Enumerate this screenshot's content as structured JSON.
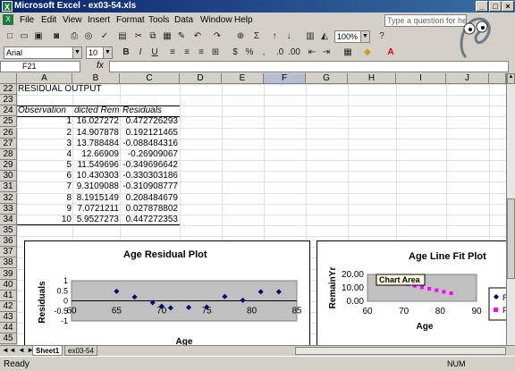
{
  "window": {
    "app": "Microsoft Excel",
    "file": "ex03-54.xls",
    "title": "Microsoft Excel - ex03-54.xls"
  },
  "menu": [
    "File",
    "Edit",
    "View",
    "Insert",
    "Format",
    "Tools",
    "Data",
    "Window",
    "Help"
  ],
  "help_box": {
    "placeholder": "Type a question for help"
  },
  "toolbar": {
    "zoom": "100%",
    "font": "Arial",
    "size": "10"
  },
  "formula_bar": {
    "name_box": "F21",
    "fx": "fx",
    "content": ""
  },
  "columns": [
    "A",
    "B",
    "C",
    "D",
    "E",
    "F",
    "G",
    "H",
    "I",
    "J"
  ],
  "selected_column": "F",
  "rows": [
    "22",
    "23",
    "24",
    "25",
    "26",
    "27",
    "28",
    "29",
    "30",
    "31",
    "32",
    "33",
    "34",
    "35",
    "36",
    "37",
    "38",
    "39",
    "40",
    "41",
    "42",
    "43",
    "44",
    "45"
  ],
  "residual_output": {
    "heading": "RESIDUAL OUTPUT",
    "headers": [
      "Observation",
      "Predicted Rema",
      "Residuals"
    ],
    "header_shown": "dicted Rema",
    "data": [
      [
        "1",
        "16.027272",
        "0.472726293"
      ],
      [
        "2",
        "14.907878",
        "0.192121465"
      ],
      [
        "3",
        "13.788484",
        "-0.088484316"
      ],
      [
        "4",
        "12.66909",
        "-0.26909067"
      ],
      [
        "5",
        "11.549696",
        "-0.349696642"
      ],
      [
        "6",
        "10.430303",
        "-0.330303186"
      ],
      [
        "7",
        "9.3109088",
        "-0.310908777"
      ],
      [
        "8",
        "8.1915149",
        "0.208484679"
      ],
      [
        "9",
        "7.0721211",
        "0.027878802"
      ],
      [
        "10",
        "5.9527273",
        "0.447272353"
      ]
    ]
  },
  "charts": {
    "residual": {
      "title": "Age  Residual Plot",
      "ylabel": "Residuals",
      "xlabel": "Age",
      "yticks": [
        "1",
        "0.5",
        "0",
        "-0.5",
        "-1"
      ],
      "xticks": [
        "60",
        "65",
        "70",
        "75",
        "80",
        "85"
      ]
    },
    "linefit": {
      "title": "Age Line Fit  Plot",
      "ylabel": "RemainYr",
      "xlabel": "Age",
      "yticks": [
        "20.00",
        "10.00",
        "0.00"
      ],
      "xticks": [
        "60",
        "70",
        "80",
        "90"
      ],
      "tooltip": "Chart Area",
      "legend": [
        "R",
        "P"
      ]
    }
  },
  "chart_data": [
    {
      "type": "scatter",
      "title": "Age  Residual Plot",
      "xlabel": "Age",
      "ylabel": "Residuals",
      "xlim": [
        60,
        85
      ],
      "ylim": [
        -1,
        1
      ],
      "color": "#000080",
      "x": [
        65,
        67,
        69,
        70,
        71,
        73,
        75,
        77,
        79,
        81,
        83
      ],
      "y": [
        0.47,
        0.19,
        -0.09,
        -0.27,
        -0.35,
        -0.33,
        -0.31,
        0.21,
        0.03,
        0.45,
        0.45
      ]
    },
    {
      "type": "scatter",
      "title": "Age Line Fit  Plot",
      "xlabel": "Age",
      "ylabel": "RemainYr",
      "xlim": [
        60,
        90
      ],
      "ylim": [
        0,
        20
      ],
      "series": [
        {
          "color": "#ff00ff",
          "x": [
            65,
            67,
            69,
            71,
            73,
            75,
            77,
            79,
            81,
            83
          ],
          "y": [
            16.0,
            14.9,
            13.8,
            12.7,
            11.5,
            10.4,
            9.3,
            8.2,
            7.1,
            6.0
          ]
        }
      ]
    }
  ],
  "sheets": [
    "Sheet1",
    "ex03-54"
  ],
  "status": {
    "left": "Ready",
    "right": "NUM"
  }
}
